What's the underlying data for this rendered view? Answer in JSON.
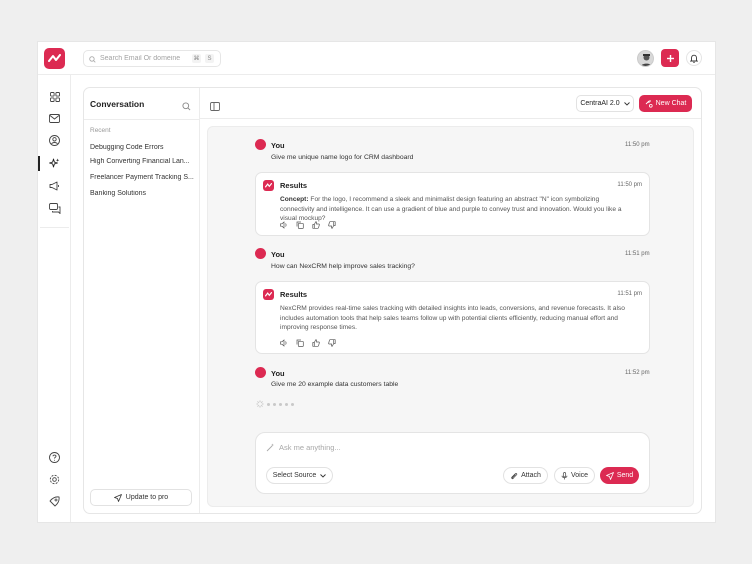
{
  "header": {
    "search_placeholder": "Search Email Or domeine",
    "shortcut_cmd": "⌘",
    "shortcut_key": "S"
  },
  "nav": {
    "icons": [
      "grid-icon",
      "mail-icon",
      "user-icon",
      "sparkle-icon",
      "megaphone-icon",
      "chat-icon"
    ],
    "bottom_icons": [
      "help-icon",
      "settings-icon",
      "rocket-icon"
    ],
    "active": "sparkle-icon"
  },
  "conversation": {
    "title": "Conversation",
    "recent_label": "Recent",
    "items": [
      "Debugging Code Errors",
      "High Converting Financial Lan...",
      "Freelancer Payment Tracking S...",
      "Banking Solutions"
    ],
    "upgrade_label": "Update to pro"
  },
  "chat_header": {
    "model": "CentraAI 2.0",
    "new_chat_label": "New Chat"
  },
  "messages": [
    {
      "author": "You",
      "time": "11:50 pm",
      "text": "Give me unique name logo for CRM dashboard"
    },
    {
      "author": "Results",
      "time": "11:50 pm",
      "label": "Concept:",
      "text": " For the logo, I recommend a sleek and minimalist design featuring an abstract \"N\" icon symbolizing connectivity and intelligence. It can use a gradient of blue and purple to convey trust and innovation. Would you like a visual mockup?"
    },
    {
      "author": "You",
      "time": "11:51 pm",
      "text": "How can NexCRM help improve sales tracking?"
    },
    {
      "author": "Results",
      "time": "11:51 pm",
      "text": "NexCRM provides real-time sales tracking with detailed insights into leads, conversions, and revenue forecasts. It also includes automation tools that help sales teams follow up with potential clients efficiently, reducing manual effort and improving response times."
    },
    {
      "author": "You",
      "time": "11:52 pm",
      "text": "Give me 20 example data customers table"
    }
  ],
  "composer": {
    "placeholder": "Ask me anything...",
    "source_label": "Select Source",
    "attach_label": "Attach",
    "voice_label": "Voice",
    "send_label": "Send"
  },
  "colors": {
    "accent": "#dc2a52"
  }
}
